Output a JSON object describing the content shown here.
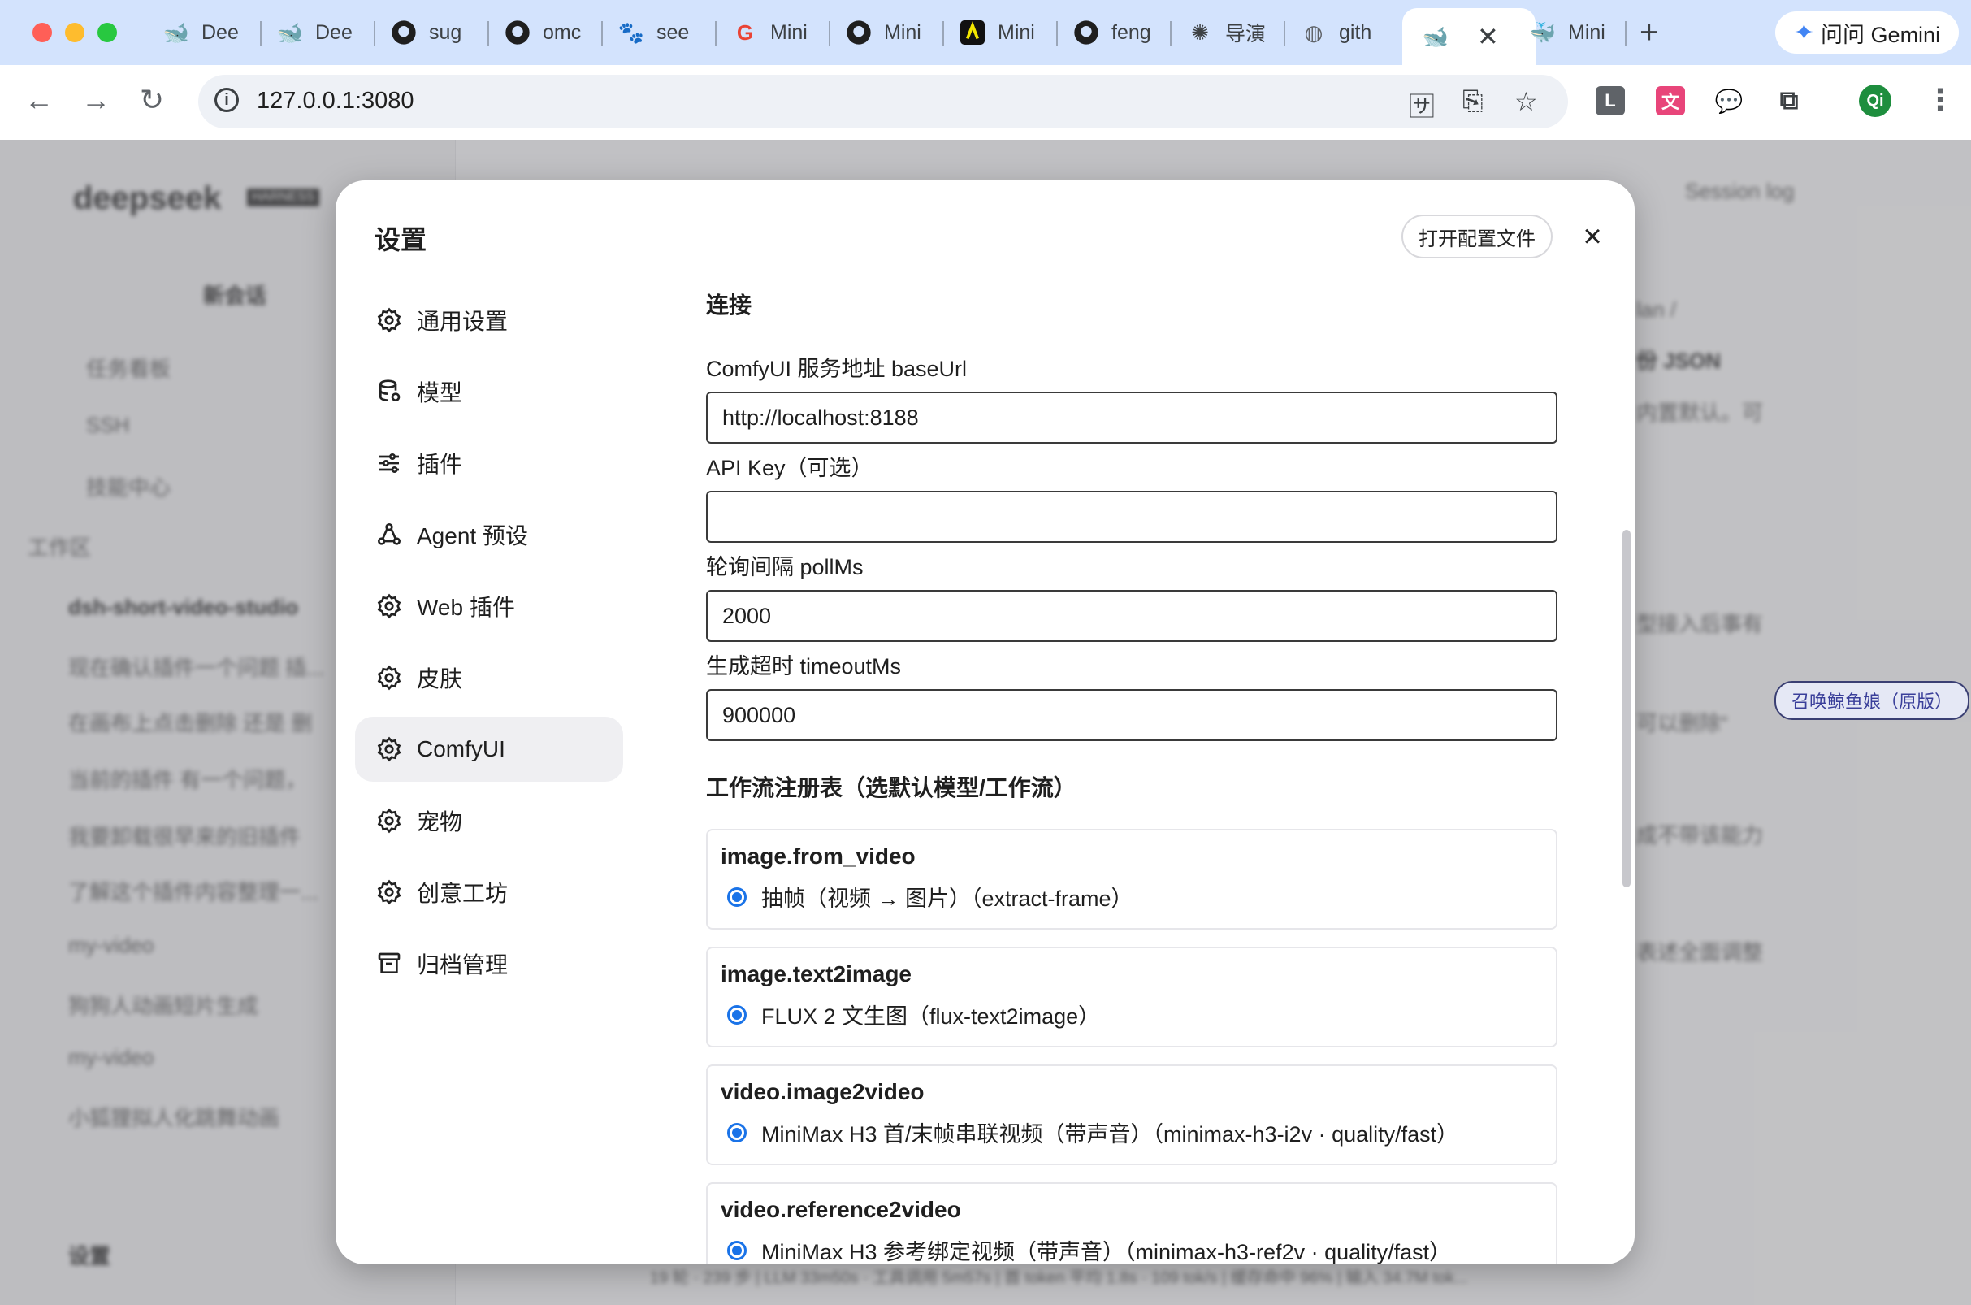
{
  "browser": {
    "tabs": [
      {
        "label": "Dee",
        "icon": "deepseek-icon"
      },
      {
        "label": "Dee",
        "icon": "deepseek-icon"
      },
      {
        "label": "sug",
        "icon": "github-icon"
      },
      {
        "label": "omc",
        "icon": "github-icon"
      },
      {
        "label": "see",
        "icon": "baidu-icon"
      },
      {
        "label": "Mini",
        "icon": "google-icon"
      },
      {
        "label": "Mini",
        "icon": "github-icon"
      },
      {
        "label": "Mini",
        "icon": "minimax-icon"
      },
      {
        "label": "feng",
        "icon": "github-icon"
      },
      {
        "label": "导演",
        "icon": "openai-icon"
      },
      {
        "label": "gith",
        "icon": "globe-icon"
      }
    ],
    "active_tab_icon": "deepseek-icon",
    "last_tab": {
      "label": "Mini",
      "icon": "agent-icon"
    },
    "new_tab": "+",
    "gemini_label": "问问 Gemini",
    "url": "127.0.0.1:3080",
    "profile_initials": "Qi",
    "ext_letter": "L"
  },
  "background": {
    "brand": "deepseek",
    "brand_badge": "HARNESS",
    "new_chat": "新会话",
    "sidebar_items": [
      "任务看板",
      "SSH",
      "技能中心"
    ],
    "workspace_label": "工作区",
    "project": "dsh-short-video-studio",
    "sessions": [
      "现在确认插件一个问题 插...",
      "在画布上点击删除 还是 删",
      "当前的插件 有一个问题，",
      "我要卸载很早来的旧插件",
      "了解这个插件内容整理一..."
    ],
    "project2": "my-video",
    "sessions2": [
      "狗狗人动画短片生成",
      "my-video",
      "小狐狸拟人化跳舞动画"
    ],
    "settings": "设置",
    "session_log": "Session log",
    "chat_snippets": [
      "lan /",
      "份 JSON",
      "内置默认。可",
      "型接入后事有",
      "可以删除“",
      "成不带该能力",
      "表述全面调整"
    ],
    "status_bar": "19 轮 · 239 步 | LLM 33m50s · 工具调用 5m57s | 首 token 平均 1.8s · 109 tok/s | 缓存命中 96% | 输入 34.7M tok...",
    "summon_badge": "召唤鲸鱼娘（原版）"
  },
  "modal": {
    "title": "设置",
    "open_config": "打开配置文件",
    "close": "×",
    "nav": [
      {
        "label": "通用设置",
        "icon": "gear-icon",
        "active": false
      },
      {
        "label": "模型",
        "icon": "database-icon",
        "active": false
      },
      {
        "label": "插件",
        "icon": "sliders-icon",
        "active": false
      },
      {
        "label": "Agent 预设",
        "icon": "agent-preset-icon",
        "active": false
      },
      {
        "label": "Web 插件",
        "icon": "gear-icon",
        "active": false
      },
      {
        "label": "皮肤",
        "icon": "gear-icon",
        "active": false
      },
      {
        "label": "ComfyUI",
        "icon": "gear-icon",
        "active": true
      },
      {
        "label": "宠物",
        "icon": "gear-icon",
        "active": false
      },
      {
        "label": "创意工坊",
        "icon": "gear-icon",
        "active": false
      },
      {
        "label": "归档管理",
        "icon": "archive-icon",
        "active": false
      }
    ],
    "connection": {
      "title": "连接",
      "fields": [
        {
          "label": "ComfyUI 服务地址 baseUrl",
          "value": "http://localhost:8188"
        },
        {
          "label": "API Key（可选）",
          "value": ""
        },
        {
          "label": "轮询间隔 pollMs",
          "value": "2000"
        },
        {
          "label": "生成超时 timeoutMs",
          "value": "900000"
        }
      ]
    },
    "workflow": {
      "title": "工作流注册表（选默认模型/工作流）",
      "cards": [
        {
          "key": "image.from_video",
          "option": "抽帧（视频 → 图片）（extract-frame）"
        },
        {
          "key": "image.text2image",
          "option": "FLUX 2 文生图（flux-text2image）"
        },
        {
          "key": "video.image2video",
          "option": "MiniMax H3 首/末帧串联视频（带声音）（minimax-h3-i2v · quality/fast）"
        },
        {
          "key": "video.reference2video",
          "option": "MiniMax H3 参考绑定视频（带声音）（minimax-h3-ref2v · quality/fast）"
        }
      ]
    }
  }
}
